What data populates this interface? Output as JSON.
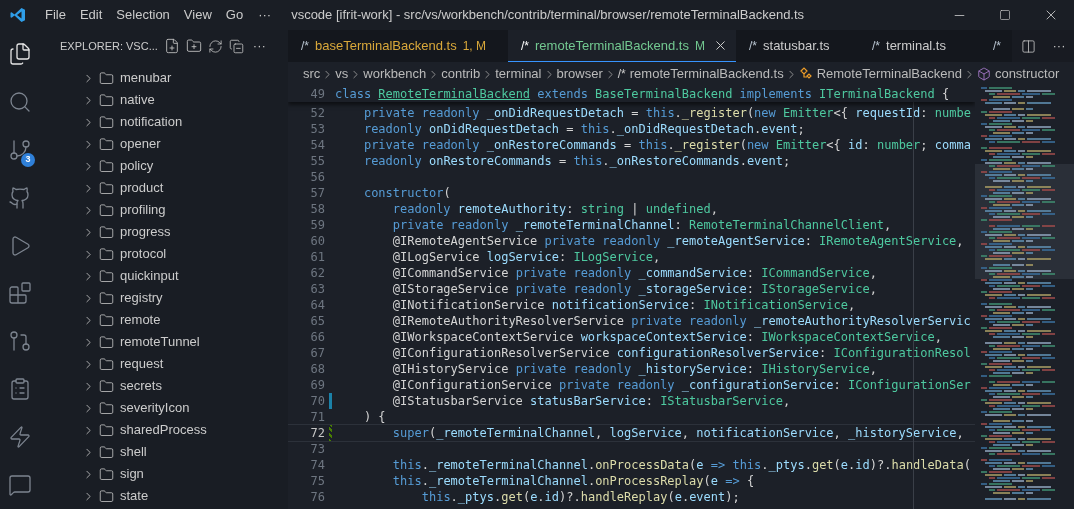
{
  "title_bar": {
    "menus": [
      "File",
      "Edit",
      "Selection",
      "View",
      "Go"
    ],
    "more": "···",
    "title": "vscode [ifrit-work] - src/vs/workbench/contrib/terminal/browser/remoteTerminalBackend.ts"
  },
  "activity_bar": [
    {
      "kind": "files",
      "selected": true
    },
    {
      "kind": "search",
      "selected": false
    },
    {
      "kind": "scm",
      "selected": false,
      "badge": "3"
    },
    {
      "kind": "github",
      "selected": false
    },
    {
      "kind": "debug",
      "selected": false
    },
    {
      "kind": "extensions",
      "selected": false
    },
    {
      "kind": "pull-requests",
      "selected": false
    },
    {
      "kind": "remote",
      "selected": false
    },
    {
      "kind": "lightning",
      "selected": false
    },
    {
      "kind": "chat",
      "selected": false
    }
  ],
  "sidebar": {
    "title": "EXPLORER: VSC...",
    "more": "···",
    "items": [
      {
        "label": "menubar",
        "expanded": false
      },
      {
        "label": "native",
        "expanded": false
      },
      {
        "label": "notification",
        "expanded": false
      },
      {
        "label": "opener",
        "expanded": false
      },
      {
        "label": "policy",
        "expanded": false
      },
      {
        "label": "product",
        "expanded": false
      },
      {
        "label": "profiling",
        "expanded": false
      },
      {
        "label": "progress",
        "expanded": false
      },
      {
        "label": "protocol",
        "expanded": false
      },
      {
        "label": "quickinput",
        "expanded": false
      },
      {
        "label": "registry",
        "expanded": false
      },
      {
        "label": "remote",
        "expanded": false
      },
      {
        "label": "remoteTunnel",
        "expanded": false
      },
      {
        "label": "request",
        "expanded": false
      },
      {
        "label": "secrets",
        "expanded": false
      },
      {
        "label": "severityIcon",
        "expanded": false
      },
      {
        "label": "sharedProcess",
        "expanded": false
      },
      {
        "label": "shell",
        "expanded": false
      },
      {
        "label": "sign",
        "expanded": false
      },
      {
        "label": "state",
        "expanded": false
      }
    ]
  },
  "tabs": [
    {
      "icon": "/*",
      "label": "baseTerminalBackend.ts",
      "status": "1, M",
      "color": "#d9a83a",
      "selected": false
    },
    {
      "icon": "/*",
      "label": "remoteTerminalBackend.ts",
      "status": "M",
      "color": "#73c991",
      "selected": true
    },
    {
      "icon": "/*",
      "label": "statusbar.ts",
      "color": "#cccccc",
      "selected": false
    },
    {
      "icon": "/*",
      "label": "terminal.ts",
      "color": "#cccccc",
      "selected": false
    },
    {
      "icon": "/*",
      "selected": false
    }
  ],
  "breadcrumb": [
    {
      "kind": "folder",
      "label": "src"
    },
    {
      "kind": "folder",
      "label": "vs"
    },
    {
      "kind": "folder",
      "label": "workbench"
    },
    {
      "kind": "folder",
      "label": "contrib"
    },
    {
      "kind": "folder",
      "label": "terminal"
    },
    {
      "kind": "folder",
      "label": "browser"
    },
    {
      "kind": "file",
      "icon": "/*",
      "label": "remoteTerminalBackend.ts"
    },
    {
      "kind": "class",
      "label": "RemoteTerminalBackend"
    },
    {
      "kind": "method",
      "label": "constructor"
    }
  ],
  "editor": {
    "sticky": {
      "number": "49",
      "tokens": [
        {
          "kind": "keyword",
          "text": "class "
        },
        {
          "kind": "link",
          "text": "RemoteTerminalBackend"
        },
        {
          "kind": "keyword",
          "text": " extends "
        },
        {
          "kind": "type",
          "text": "BaseTerminalBackend"
        },
        {
          "kind": "keyword",
          "text": " implements "
        },
        {
          "kind": "type",
          "text": "ITerminalBackend"
        },
        {
          "kind": "plain",
          "text": " {"
        }
      ]
    },
    "lines": [
      {
        "number": "52",
        "current": false,
        "tokens": [
          {
            "kind": "keyword",
            "text": "\tprivate readonly "
          },
          {
            "kind": "variable",
            "text": "_onDidRequestDetach"
          },
          {
            "kind": "plain",
            "text": " = "
          },
          {
            "kind": "keyword",
            "text": "this"
          },
          {
            "kind": "plain",
            "text": "."
          },
          {
            "kind": "function",
            "text": "_register"
          },
          {
            "kind": "plain",
            "text": "("
          },
          {
            "kind": "keyword",
            "text": "new "
          },
          {
            "kind": "type",
            "text": "Emitter"
          },
          {
            "kind": "plain",
            "text": "<{ "
          },
          {
            "kind": "variable",
            "text": "requestId"
          },
          {
            "kind": "plain",
            "text": ": "
          },
          {
            "kind": "type",
            "text": "numbe"
          }
        ]
      },
      {
        "number": "53",
        "current": false,
        "tokens": [
          {
            "kind": "keyword",
            "text": "\treadonly "
          },
          {
            "kind": "variable",
            "text": "onDidRequestDetach"
          },
          {
            "kind": "plain",
            "text": " = "
          },
          {
            "kind": "keyword",
            "text": "this"
          },
          {
            "kind": "plain",
            "text": "."
          },
          {
            "kind": "variable",
            "text": "_onDidRequestDetach"
          },
          {
            "kind": "plain",
            "text": "."
          },
          {
            "kind": "variable",
            "text": "event"
          },
          {
            "kind": "plain",
            "text": ";"
          }
        ]
      },
      {
        "number": "54",
        "current": false,
        "tokens": [
          {
            "kind": "keyword",
            "text": "\tprivate readonly "
          },
          {
            "kind": "variable",
            "text": "_onRestoreCommands"
          },
          {
            "kind": "plain",
            "text": " = "
          },
          {
            "kind": "keyword",
            "text": "this"
          },
          {
            "kind": "plain",
            "text": "."
          },
          {
            "kind": "function",
            "text": "_register"
          },
          {
            "kind": "plain",
            "text": "("
          },
          {
            "kind": "keyword",
            "text": "new "
          },
          {
            "kind": "type",
            "text": "Emitter"
          },
          {
            "kind": "plain",
            "text": "<{ "
          },
          {
            "kind": "variable",
            "text": "id"
          },
          {
            "kind": "plain",
            "text": ": "
          },
          {
            "kind": "type",
            "text": "number"
          },
          {
            "kind": "plain",
            "text": "; "
          },
          {
            "kind": "variable",
            "text": "comma"
          }
        ]
      },
      {
        "number": "55",
        "current": false,
        "tokens": [
          {
            "kind": "keyword",
            "text": "\treadonly "
          },
          {
            "kind": "variable",
            "text": "onRestoreCommands"
          },
          {
            "kind": "plain",
            "text": " = "
          },
          {
            "kind": "keyword",
            "text": "this"
          },
          {
            "kind": "plain",
            "text": "."
          },
          {
            "kind": "variable",
            "text": "_onRestoreCommands"
          },
          {
            "kind": "plain",
            "text": "."
          },
          {
            "kind": "variable",
            "text": "event"
          },
          {
            "kind": "plain",
            "text": ";"
          }
        ]
      },
      {
        "number": "56",
        "current": false
      },
      {
        "number": "57",
        "current": false,
        "tokens": [
          {
            "kind": "keyword",
            "text": "\tconstructor"
          },
          {
            "kind": "plain",
            "text": "("
          }
        ]
      },
      {
        "number": "58",
        "current": false,
        "tokens": [
          {
            "kind": "keyword",
            "text": "\t\treadonly "
          },
          {
            "kind": "variable",
            "text": "remoteAuthority"
          },
          {
            "kind": "plain",
            "text": ": "
          },
          {
            "kind": "type",
            "text": "string"
          },
          {
            "kind": "plain",
            "text": " | "
          },
          {
            "kind": "type",
            "text": "undefined"
          },
          {
            "kind": "plain",
            "text": ","
          }
        ]
      },
      {
        "number": "59",
        "current": false,
        "tokens": [
          {
            "kind": "keyword",
            "text": "\t\tprivate readonly "
          },
          {
            "kind": "variable",
            "text": "_remoteTerminalChannel"
          },
          {
            "kind": "plain",
            "text": ": "
          },
          {
            "kind": "type",
            "text": "RemoteTerminalChannelClient"
          },
          {
            "kind": "plain",
            "text": ","
          }
        ]
      },
      {
        "number": "60",
        "current": false,
        "tokens": [
          {
            "kind": "plain",
            "text": "\t\t@IRemoteAgentService "
          },
          {
            "kind": "keyword",
            "text": "private readonly "
          },
          {
            "kind": "variable",
            "text": "_remoteAgentService"
          },
          {
            "kind": "plain",
            "text": ": "
          },
          {
            "kind": "type",
            "text": "IRemoteAgentService"
          },
          {
            "kind": "plain",
            "text": ","
          }
        ]
      },
      {
        "number": "61",
        "current": false,
        "tokens": [
          {
            "kind": "plain",
            "text": "\t\t@ILogService "
          },
          {
            "kind": "variable",
            "text": "logService"
          },
          {
            "kind": "plain",
            "text": ": "
          },
          {
            "kind": "type",
            "text": "ILogService"
          },
          {
            "kind": "plain",
            "text": ","
          }
        ]
      },
      {
        "number": "62",
        "current": false,
        "tokens": [
          {
            "kind": "plain",
            "text": "\t\t@ICommandService "
          },
          {
            "kind": "keyword",
            "text": "private readonly "
          },
          {
            "kind": "variable",
            "text": "_commandService"
          },
          {
            "kind": "plain",
            "text": ": "
          },
          {
            "kind": "type",
            "text": "ICommandService"
          },
          {
            "kind": "plain",
            "text": ","
          }
        ]
      },
      {
        "number": "63",
        "current": false,
        "tokens": [
          {
            "kind": "plain",
            "text": "\t\t@IStorageService "
          },
          {
            "kind": "keyword",
            "text": "private readonly "
          },
          {
            "kind": "variable",
            "text": "_storageService"
          },
          {
            "kind": "plain",
            "text": ": "
          },
          {
            "kind": "type",
            "text": "IStorageService"
          },
          {
            "kind": "plain",
            "text": ","
          }
        ]
      },
      {
        "number": "64",
        "current": false,
        "tokens": [
          {
            "kind": "plain",
            "text": "\t\t@INotificationService "
          },
          {
            "kind": "variable",
            "text": "notificationService"
          },
          {
            "kind": "plain",
            "text": ": "
          },
          {
            "kind": "type",
            "text": "INotificationService"
          },
          {
            "kind": "plain",
            "text": ","
          }
        ]
      },
      {
        "number": "65",
        "current": false,
        "tokens": [
          {
            "kind": "plain",
            "text": "\t\t@IRemoteAuthorityResolverService "
          },
          {
            "kind": "keyword",
            "text": "private readonly "
          },
          {
            "kind": "variable",
            "text": "_remoteAuthorityResolverServic"
          }
        ]
      },
      {
        "number": "66",
        "current": false,
        "tokens": [
          {
            "kind": "plain",
            "text": "\t\t@IWorkspaceContextService "
          },
          {
            "kind": "variable",
            "text": "workspaceContextService"
          },
          {
            "kind": "plain",
            "text": ": "
          },
          {
            "kind": "type",
            "text": "IWorkspaceContextService"
          },
          {
            "kind": "plain",
            "text": ","
          }
        ]
      },
      {
        "number": "67",
        "current": false,
        "tokens": [
          {
            "kind": "plain",
            "text": "\t\t@IConfigurationResolverService "
          },
          {
            "kind": "variable",
            "text": "configurationResolverService"
          },
          {
            "kind": "plain",
            "text": ": "
          },
          {
            "kind": "type",
            "text": "IConfigurationResol"
          }
        ]
      },
      {
        "number": "68",
        "current": false,
        "tokens": [
          {
            "kind": "plain",
            "text": "\t\t@IHistoryService "
          },
          {
            "kind": "keyword",
            "text": "private readonly "
          },
          {
            "kind": "variable",
            "text": "_historyService"
          },
          {
            "kind": "plain",
            "text": ": "
          },
          {
            "kind": "type",
            "text": "IHistoryService"
          },
          {
            "kind": "plain",
            "text": ","
          }
        ]
      },
      {
        "number": "69",
        "current": false,
        "tokens": [
          {
            "kind": "plain",
            "text": "\t\t@IConfigurationService "
          },
          {
            "kind": "keyword",
            "text": "private readonly "
          },
          {
            "kind": "variable",
            "text": "_configurationService"
          },
          {
            "kind": "plain",
            "text": ": "
          },
          {
            "kind": "type",
            "text": "IConfigurationSer"
          }
        ]
      },
      {
        "number": "70",
        "current": false,
        "modified": true,
        "tokens": [
          {
            "kind": "plain",
            "text": "\t\t@IStatusbarService "
          },
          {
            "kind": "variable",
            "text": "statusBarService"
          },
          {
            "kind": "plain",
            "text": ": "
          },
          {
            "kind": "type",
            "text": "IStatusbarService"
          },
          {
            "kind": "plain",
            "text": ","
          }
        ]
      },
      {
        "number": "71",
        "current": false,
        "tokens": [
          {
            "kind": "plain",
            "text": "\t) {"
          }
        ]
      },
      {
        "number": "72",
        "current": true,
        "added": true,
        "tokens": [
          {
            "kind": "keyword",
            "text": "\t\tsuper"
          },
          {
            "kind": "plain",
            "text": "("
          },
          {
            "kind": "variable",
            "text": "_remoteTerminalChannel"
          },
          {
            "kind": "plain",
            "text": ", "
          },
          {
            "kind": "variable",
            "text": "logService"
          },
          {
            "kind": "plain",
            "text": ", "
          },
          {
            "kind": "variable",
            "text": "notificationService"
          },
          {
            "kind": "plain",
            "text": ", "
          },
          {
            "kind": "variable",
            "text": "_historyService"
          },
          {
            "kind": "plain",
            "text": ","
          }
        ]
      },
      {
        "number": "73",
        "current": false
      },
      {
        "number": "74",
        "current": false,
        "tokens": [
          {
            "kind": "keyword",
            "text": "\t\tthis"
          },
          {
            "kind": "plain",
            "text": "."
          },
          {
            "kind": "variable",
            "text": "_remoteTerminalChannel"
          },
          {
            "kind": "plain",
            "text": "."
          },
          {
            "kind": "function",
            "text": "onProcessData"
          },
          {
            "kind": "plain",
            "text": "("
          },
          {
            "kind": "variable",
            "text": "e"
          },
          {
            "kind": "keyword",
            "text": " => this"
          },
          {
            "kind": "plain",
            "text": "."
          },
          {
            "kind": "variable",
            "text": "_ptys"
          },
          {
            "kind": "plain",
            "text": "."
          },
          {
            "kind": "function",
            "text": "get"
          },
          {
            "kind": "plain",
            "text": "("
          },
          {
            "kind": "variable",
            "text": "e"
          },
          {
            "kind": "plain",
            "text": "."
          },
          {
            "kind": "variable",
            "text": "id"
          },
          {
            "kind": "plain",
            "text": ")?."
          },
          {
            "kind": "function",
            "text": "handleData"
          },
          {
            "kind": "plain",
            "text": "("
          }
        ]
      },
      {
        "number": "75",
        "current": false,
        "tokens": [
          {
            "kind": "keyword",
            "text": "\t\tthis"
          },
          {
            "kind": "plain",
            "text": "."
          },
          {
            "kind": "variable",
            "text": "_remoteTerminalChannel"
          },
          {
            "kind": "plain",
            "text": "."
          },
          {
            "kind": "function",
            "text": "onProcessReplay"
          },
          {
            "kind": "plain",
            "text": "("
          },
          {
            "kind": "variable",
            "text": "e"
          },
          {
            "kind": "keyword",
            "text": " => "
          },
          {
            "kind": "plain",
            "text": "{"
          }
        ]
      },
      {
        "number": "76",
        "current": false,
        "tokens": [
          {
            "kind": "keyword",
            "text": "\t\t\tthis"
          },
          {
            "kind": "plain",
            "text": "."
          },
          {
            "kind": "variable",
            "text": "_ptys"
          },
          {
            "kind": "plain",
            "text": "."
          },
          {
            "kind": "function",
            "text": "get"
          },
          {
            "kind": "plain",
            "text": "("
          },
          {
            "kind": "variable",
            "text": "e"
          },
          {
            "kind": "plain",
            "text": "."
          },
          {
            "kind": "variable",
            "text": "id"
          },
          {
            "kind": "plain",
            "text": ")?."
          },
          {
            "kind": "function",
            "text": "handleReplay"
          },
          {
            "kind": "plain",
            "text": "("
          },
          {
            "kind": "variable",
            "text": "e"
          },
          {
            "kind": "plain",
            "text": "."
          },
          {
            "kind": "variable",
            "text": "event"
          },
          {
            "kind": "plain",
            "text": ");"
          }
        ]
      }
    ]
  }
}
